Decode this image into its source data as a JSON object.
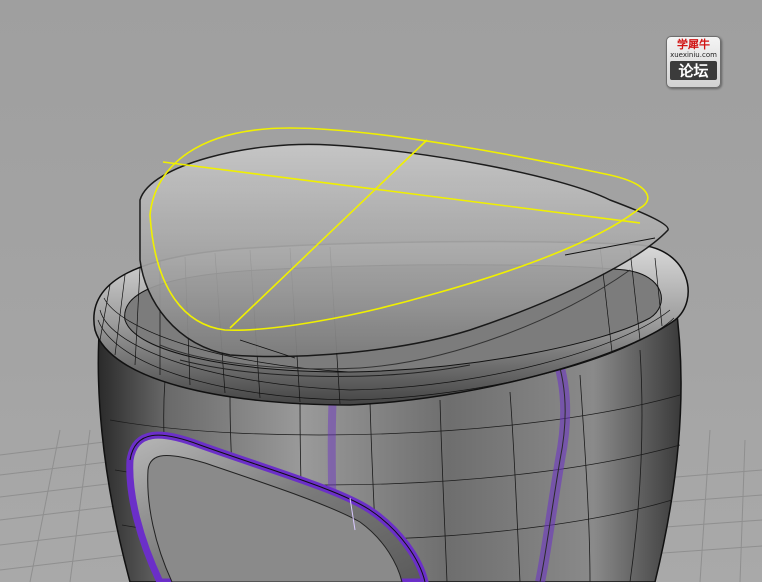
{
  "viewport": {
    "background": "#a2a2a2",
    "grid_color": "#8f8f8f",
    "grid_axis_color": "#3f8f3f",
    "selected_curve_color": "#f0f000",
    "trim_edge_color": "#6b2fc8",
    "surface_color": "#8c8c8c",
    "mesh_edge_color": "#101010"
  },
  "watermark": {
    "top_text": "学犀牛",
    "domain_text": "xuexiniu.com",
    "bottom_text": "论坛"
  },
  "icons": {
    "logo": "xuexiniu-forum-logo"
  }
}
